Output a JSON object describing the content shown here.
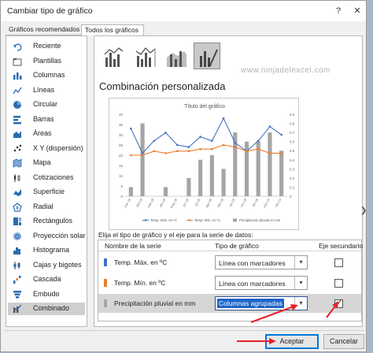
{
  "window": {
    "title": "Cambiar tipo de gráfico",
    "help_glyph": "?",
    "close_glyph": "✕"
  },
  "tabs": [
    {
      "label": "Gráficos recomendados",
      "active": false
    },
    {
      "label": "Todos los gráficos",
      "active": true
    }
  ],
  "sidebar": {
    "items": [
      {
        "label": "Reciente",
        "icon": "undo-arrow-icon"
      },
      {
        "label": "Plantillas",
        "icon": "folder-icon"
      },
      {
        "label": "Columnas",
        "icon": "column-chart-icon"
      },
      {
        "label": "Líneas",
        "icon": "line-chart-icon"
      },
      {
        "label": "Circular",
        "icon": "pie-chart-icon"
      },
      {
        "label": "Barras",
        "icon": "bar-chart-icon"
      },
      {
        "label": "Áreas",
        "icon": "area-chart-icon"
      },
      {
        "label": "X Y (dispersión)",
        "icon": "scatter-chart-icon"
      },
      {
        "label": "Mapa",
        "icon": "map-chart-icon"
      },
      {
        "label": "Cotizaciones",
        "icon": "stock-chart-icon"
      },
      {
        "label": "Superficie",
        "icon": "surface-chart-icon"
      },
      {
        "label": "Radial",
        "icon": "radar-chart-icon"
      },
      {
        "label": "Rectángulos",
        "icon": "treemap-chart-icon"
      },
      {
        "label": "Proyección solar",
        "icon": "sunburst-chart-icon"
      },
      {
        "label": "Histograma",
        "icon": "histogram-chart-icon"
      },
      {
        "label": "Cajas y bigotes",
        "icon": "box-whisker-chart-icon"
      },
      {
        "label": "Cascada",
        "icon": "waterfall-chart-icon"
      },
      {
        "label": "Embudo",
        "icon": "funnel-chart-icon"
      },
      {
        "label": "Combinado",
        "icon": "combo-chart-icon",
        "selected": true
      }
    ]
  },
  "combo_types": [
    {
      "name": "clustered-column-line-icon",
      "active": false
    },
    {
      "name": "clustered-column-line-secondary-icon",
      "active": false
    },
    {
      "name": "stacked-area-column-icon",
      "active": false
    },
    {
      "name": "custom-combination-icon",
      "active": true
    }
  ],
  "watermark": "www.ninjadelexcel.com",
  "heading": "Combinación personalizada",
  "chart_data": {
    "type": "combo",
    "title": "Título del gráfico",
    "categories": [
      "ene-18",
      "feb-18",
      "mar-18",
      "abr-18",
      "may-18",
      "jun-18",
      "jul-18",
      "ago-18",
      "sep-18",
      "oct-18",
      "nov-18",
      "dic-18",
      "ene-19",
      "feb-19"
    ],
    "y_ticks": [
      "0",
      "5",
      "10",
      "15",
      "20",
      "25",
      "30",
      "35",
      "40"
    ],
    "y2_ticks": [
      "0",
      "0.1",
      "0.2",
      "0.3",
      "0.4",
      "0.5",
      "0.6",
      "0.7",
      "0.8",
      "0.9"
    ],
    "ylim": [
      0,
      40
    ],
    "y2lim": [
      0,
      0.9
    ],
    "series": [
      {
        "name": "Temp. Máx. en ºC",
        "type": "line",
        "axis": "primary",
        "color": "#4472c4",
        "values": [
          33,
          21,
          27,
          31,
          25,
          24,
          29,
          27,
          38,
          26,
          22,
          27,
          34,
          30
        ]
      },
      {
        "name": "Temp. Mín. en ºC",
        "type": "line",
        "axis": "primary",
        "color": "#ed7d31",
        "values": [
          20,
          20,
          22,
          21,
          22,
          22,
          23,
          23,
          25,
          24,
          22,
          23,
          21,
          21
        ]
      },
      {
        "name": "Precipitación pluvial en mm",
        "type": "bar",
        "axis": "secondary",
        "color": "#a5a5a5",
        "values": [
          0.1,
          0.8,
          0,
          0.1,
          0,
          0.2,
          0.4,
          0.45,
          0.3,
          0.7,
          0.6,
          0.6,
          0.7,
          0.5
        ]
      }
    ],
    "legend_position": "bottom",
    "grid": false
  },
  "instruction": "Elija el tipo de gráfico y el eje para la serie de datos:",
  "table": {
    "headers": {
      "name": "Nombre de la serie",
      "type": "Tipo de gráfico",
      "secondary": "Eje secundario"
    },
    "rows": [
      {
        "name": "Temp. Máx. en ºC",
        "color": "#4472c4",
        "type": "Línea con marcadores",
        "secondary": false,
        "selected": false
      },
      {
        "name": "Temp. Mín. en ºC",
        "color": "#ed7d31",
        "type": "Línea con marcadores",
        "secondary": false,
        "selected": false
      },
      {
        "name": "Precipitación pluvial en mm",
        "color": "#a5a5a5",
        "type": "Columnas agrupadas",
        "secondary": true,
        "selected": true
      }
    ]
  },
  "buttons": {
    "accept": "Aceptar",
    "cancel": "Cancelar"
  },
  "colors": {
    "annotation": "#e8202a",
    "accent": "#0078d7"
  }
}
